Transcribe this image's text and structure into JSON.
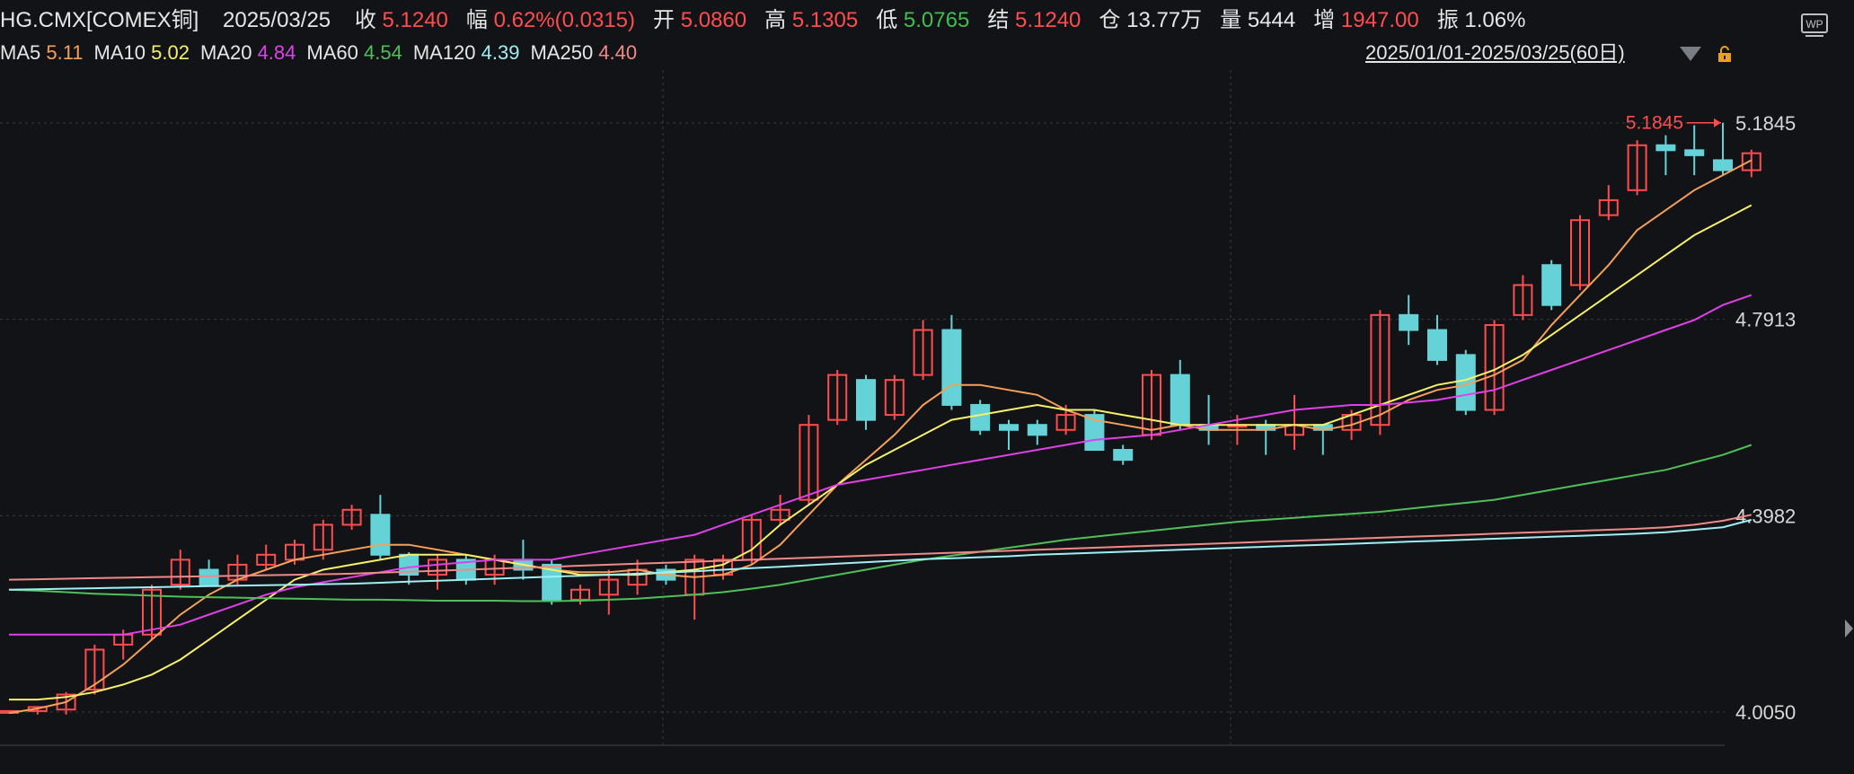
{
  "header": {
    "symbol": "HG.CMX[COMEX铜]",
    "date": "2025/03/25",
    "close_label": "收",
    "close_value": "5.1240",
    "change_label": "幅",
    "change_value": "0.62%(0.0315)",
    "open_label": "开",
    "open_value": "5.0860",
    "high_label": "高",
    "high_value": "5.1305",
    "low_label": "低",
    "low_value": "5.0765",
    "settle_label": "结",
    "settle_value": "5.1240",
    "oi_label": "仓",
    "oi_value": "13.77万",
    "volume_label": "量",
    "volume_value": "5444",
    "increase_label": "增",
    "increase_value": "1947.00",
    "amplitude_label": "振",
    "amplitude_value": "1.06%"
  },
  "ma_legend": [
    {
      "label": "MA5",
      "value": "5.11",
      "color": "#f5a05a"
    },
    {
      "label": "MA10",
      "value": "5.02",
      "color": "#f7f06a"
    },
    {
      "label": "MA20",
      "value": "4.84",
      "color": "#e040e8"
    },
    {
      "label": "MA60",
      "value": "4.54",
      "color": "#4fbf5a"
    },
    {
      "label": "MA120",
      "value": "4.39",
      "color": "#9ef0f5"
    },
    {
      "label": "MA250",
      "value": "4.40",
      "color": "#f08a8a"
    }
  ],
  "range_label": "2025/01/01-2025/03/25(60日)",
  "icons": {
    "dropdown": "triangle-down-icon",
    "lock": "lock-icon",
    "wp": "wp-logo-icon",
    "edge": "chevron-right-icon"
  },
  "wp_text": "WP",
  "colors": {
    "up": "#ff4d4f",
    "down": "#64d2d6",
    "grid": "#3a3c42",
    "axis_text": "#d8d8d8"
  },
  "chart_data": {
    "type": "candlestick",
    "ylim": [
      4.005,
      5.1845
    ],
    "y_ticks": [
      "5.1845",
      "4.7913",
      "4.3982",
      "4.0050"
    ],
    "max_label": "5.1845",
    "candles": [
      [
        4.004,
        4.007,
        4.003,
        4.006
      ],
      [
        4.007,
        4.015,
        4.0,
        4.012
      ],
      [
        4.01,
        4.04,
        4.0,
        4.045
      ],
      [
        4.05,
        4.13,
        4.04,
        4.14
      ],
      [
        4.14,
        4.16,
        4.11,
        4.17
      ],
      [
        4.16,
        4.25,
        4.15,
        4.26
      ],
      [
        4.26,
        4.31,
        4.25,
        4.33
      ],
      [
        4.29,
        4.26,
        4.27,
        4.31
      ],
      [
        4.27,
        4.3,
        4.26,
        4.32
      ],
      [
        4.3,
        4.32,
        4.29,
        4.34
      ],
      [
        4.31,
        4.34,
        4.3,
        4.35
      ],
      [
        4.33,
        4.38,
        4.31,
        4.39
      ],
      [
        4.38,
        4.41,
        4.37,
        4.42
      ],
      [
        4.4,
        4.32,
        4.31,
        4.44
      ],
      [
        4.32,
        4.28,
        4.26,
        4.325
      ],
      [
        4.28,
        4.31,
        4.25,
        4.32
      ],
      [
        4.31,
        4.27,
        4.26,
        4.32
      ],
      [
        4.28,
        4.31,
        4.26,
        4.32
      ],
      [
        4.31,
        4.29,
        4.27,
        4.35
      ],
      [
        4.3,
        4.23,
        4.22,
        4.31
      ],
      [
        4.23,
        4.25,
        4.22,
        4.26
      ],
      [
        4.24,
        4.27,
        4.2,
        4.29
      ],
      [
        4.26,
        4.29,
        4.24,
        4.31
      ],
      [
        4.29,
        4.27,
        4.26,
        4.3
      ],
      [
        4.24,
        4.31,
        4.19,
        4.32
      ],
      [
        4.28,
        4.31,
        4.27,
        4.32
      ],
      [
        4.31,
        4.39,
        4.3,
        4.4
      ],
      [
        4.39,
        4.41,
        4.38,
        4.44
      ],
      [
        4.43,
        4.58,
        4.42,
        4.6
      ],
      [
        4.59,
        4.68,
        4.58,
        4.69
      ],
      [
        4.67,
        4.59,
        4.57,
        4.68
      ],
      [
        4.6,
        4.67,
        4.59,
        4.68
      ],
      [
        4.68,
        4.77,
        4.67,
        4.79
      ],
      [
        4.77,
        4.62,
        4.61,
        4.8
      ],
      [
        4.62,
        4.57,
        4.56,
        4.63
      ],
      [
        4.58,
        4.57,
        4.53,
        4.59
      ],
      [
        4.58,
        4.56,
        4.54,
        4.59
      ],
      [
        4.57,
        4.6,
        4.56,
        4.62
      ],
      [
        4.6,
        4.53,
        4.53,
        4.61
      ],
      [
        4.53,
        4.51,
        4.5,
        4.54
      ],
      [
        4.56,
        4.68,
        4.55,
        4.69
      ],
      [
        4.68,
        4.58,
        4.57,
        4.71
      ],
      [
        4.58,
        4.57,
        4.54,
        4.64
      ],
      [
        4.58,
        4.58,
        4.54,
        4.6
      ],
      [
        4.58,
        4.57,
        4.52,
        4.59
      ],
      [
        4.56,
        4.58,
        4.53,
        4.64
      ],
      [
        4.58,
        4.57,
        4.52,
        4.58
      ],
      [
        4.57,
        4.6,
        4.55,
        4.61
      ],
      [
        4.58,
        4.8,
        4.56,
        4.81
      ],
      [
        4.8,
        4.77,
        4.74,
        4.84
      ],
      [
        4.77,
        4.71,
        4.7,
        4.8
      ],
      [
        4.72,
        4.61,
        4.6,
        4.73
      ],
      [
        4.61,
        4.78,
        4.6,
        4.79
      ],
      [
        4.8,
        4.86,
        4.79,
        4.88
      ],
      [
        4.9,
        4.82,
        4.81,
        4.91
      ],
      [
        4.86,
        4.99,
        4.85,
        5.0
      ],
      [
        5.0,
        5.03,
        4.99,
        5.06
      ],
      [
        5.05,
        5.14,
        5.04,
        5.15
      ],
      [
        5.14,
        5.13,
        5.08,
        5.16
      ],
      [
        5.13,
        5.12,
        5.08,
        5.18
      ],
      [
        5.11,
        5.09,
        5.08,
        5.185
      ],
      [
        5.09,
        5.124,
        5.076,
        5.131
      ]
    ],
    "ma_series": {
      "MA5": [
        4.003,
        4.012,
        4.025,
        4.06,
        4.1,
        4.15,
        4.2,
        4.24,
        4.27,
        4.29,
        4.31,
        4.32,
        4.33,
        4.34,
        4.34,
        4.33,
        4.32,
        4.31,
        4.3,
        4.29,
        4.285,
        4.285,
        4.29,
        4.28,
        4.275,
        4.28,
        4.3,
        4.34,
        4.4,
        4.46,
        4.51,
        4.56,
        4.62,
        4.66,
        4.66,
        4.65,
        4.64,
        4.61,
        4.59,
        4.58,
        4.57,
        4.58,
        4.57,
        4.57,
        4.57,
        4.58,
        4.57,
        4.58,
        4.6,
        4.63,
        4.65,
        4.66,
        4.68,
        4.71,
        4.78,
        4.84,
        4.9,
        4.97,
        5.01,
        5.05,
        5.08,
        5.11
      ],
      "MA10": [
        4.03,
        4.03,
        4.035,
        4.045,
        4.06,
        4.08,
        4.11,
        4.15,
        4.19,
        4.23,
        4.27,
        4.29,
        4.3,
        4.31,
        4.32,
        4.32,
        4.32,
        4.31,
        4.3,
        4.29,
        4.28,
        4.28,
        4.28,
        4.285,
        4.29,
        4.3,
        4.33,
        4.38,
        4.42,
        4.46,
        4.5,
        4.53,
        4.56,
        4.59,
        4.6,
        4.61,
        4.62,
        4.61,
        4.61,
        4.6,
        4.59,
        4.58,
        4.58,
        4.58,
        4.58,
        4.58,
        4.58,
        4.6,
        4.62,
        4.64,
        4.66,
        4.67,
        4.69,
        4.72,
        4.76,
        4.8,
        4.84,
        4.88,
        4.92,
        4.96,
        4.99,
        5.02
      ],
      "MA20": [
        4.16,
        4.16,
        4.16,
        4.16,
        4.16,
        4.17,
        4.18,
        4.2,
        4.22,
        4.24,
        4.255,
        4.265,
        4.275,
        4.285,
        4.295,
        4.3,
        4.305,
        4.31,
        4.31,
        4.31,
        4.32,
        4.33,
        4.34,
        4.35,
        4.36,
        4.38,
        4.4,
        4.42,
        4.44,
        4.46,
        4.47,
        4.48,
        4.49,
        4.5,
        4.51,
        4.52,
        4.53,
        4.54,
        4.55,
        4.555,
        4.56,
        4.57,
        4.58,
        4.59,
        4.6,
        4.61,
        4.615,
        4.62,
        4.62,
        4.625,
        4.63,
        4.64,
        4.65,
        4.67,
        4.69,
        4.71,
        4.73,
        4.75,
        4.77,
        4.79,
        4.82,
        4.84
      ],
      "MA60": [
        4.25,
        4.248,
        4.245,
        4.242,
        4.24,
        4.238,
        4.236,
        4.235,
        4.234,
        4.233,
        4.232,
        4.231,
        4.23,
        4.23,
        4.229,
        4.228,
        4.228,
        4.228,
        4.227,
        4.227,
        4.228,
        4.23,
        4.232,
        4.236,
        4.24,
        4.245,
        4.252,
        4.26,
        4.27,
        4.28,
        4.29,
        4.3,
        4.31,
        4.318,
        4.326,
        4.334,
        4.342,
        4.35,
        4.356,
        4.362,
        4.368,
        4.374,
        4.38,
        4.386,
        4.39,
        4.394,
        4.398,
        4.402,
        4.406,
        4.412,
        4.418,
        4.424,
        4.43,
        4.44,
        4.45,
        4.46,
        4.47,
        4.48,
        4.49,
        4.505,
        4.52,
        4.54
      ],
      "MA120": [
        4.25,
        4.251,
        4.252,
        4.253,
        4.254,
        4.255,
        4.256,
        4.257,
        4.258,
        4.259,
        4.26,
        4.261,
        4.262,
        4.264,
        4.266,
        4.268,
        4.27,
        4.272,
        4.274,
        4.276,
        4.278,
        4.28,
        4.282,
        4.284,
        4.287,
        4.29,
        4.293,
        4.296,
        4.299,
        4.302,
        4.305,
        4.308,
        4.311,
        4.313,
        4.315,
        4.317,
        4.32,
        4.322,
        4.324,
        4.326,
        4.328,
        4.33,
        4.332,
        4.334,
        4.336,
        4.338,
        4.34,
        4.342,
        4.344,
        4.346,
        4.348,
        4.35,
        4.352,
        4.354,
        4.356,
        4.358,
        4.36,
        4.362,
        4.365,
        4.37,
        4.375,
        4.39
      ],
      "MA250": [
        4.27,
        4.271,
        4.272,
        4.273,
        4.274,
        4.275,
        4.276,
        4.277,
        4.278,
        4.279,
        4.28,
        4.281,
        4.282,
        4.284,
        4.286,
        4.288,
        4.29,
        4.292,
        4.294,
        4.296,
        4.298,
        4.3,
        4.302,
        4.304,
        4.306,
        4.308,
        4.31,
        4.312,
        4.314,
        4.316,
        4.318,
        4.32,
        4.322,
        4.324,
        4.326,
        4.328,
        4.33,
        4.332,
        4.334,
        4.336,
        4.338,
        4.34,
        4.342,
        4.344,
        4.346,
        4.348,
        4.35,
        4.352,
        4.354,
        4.356,
        4.358,
        4.36,
        4.362,
        4.364,
        4.366,
        4.368,
        4.37,
        4.372,
        4.375,
        4.38,
        4.388,
        4.4
      ]
    }
  }
}
